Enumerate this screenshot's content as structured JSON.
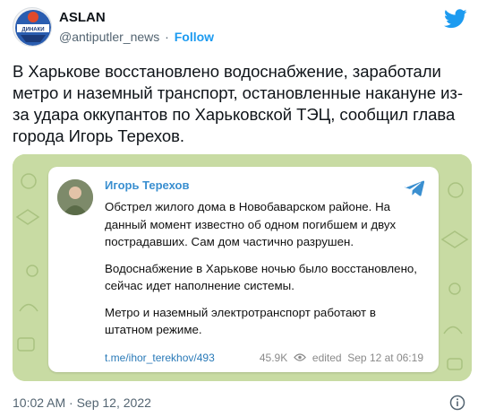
{
  "author": {
    "name": "ASLAN",
    "handle": "@antiputler_news",
    "follow_label": "Follow",
    "avatar_text": "ДИНАКИ"
  },
  "tweet": {
    "text": "В Харькове восстановлено водоснабжение, заработали метро и наземный транспорт, остановленные накануне из-за удара оккупантов по Харьковской ТЭЦ, сообщил глава города Игорь Терехов.",
    "timestamp": "10:02 AM · Sep 12, 2022"
  },
  "telegram_post": {
    "author": "Игорь Терехов",
    "paragraphs": [
      "Обстрел жилого дома в Новобаварском районе. На данный момент известно об одном погибшем и двух пострадавших. Сам дом частично разрушен.",
      "Водоснабжение в Харькове ночью было восстановлено, сейчас идет наполнение системы.",
      "Метро и наземный электротранспорт работают в штатном режиме."
    ],
    "link": "t.me/ihor_terekhov/493",
    "views": "45.9K",
    "edited": "edited  Sep 12 at 06:19"
  },
  "colors": {
    "twitter_blue": "#1d9bf0",
    "telegram_bg": "#c8dba3",
    "telegram_blue": "#3a8fd0"
  },
  "icons": [
    "twitter-logo-icon",
    "telegram-icon",
    "eye-icon",
    "info-icon"
  ]
}
